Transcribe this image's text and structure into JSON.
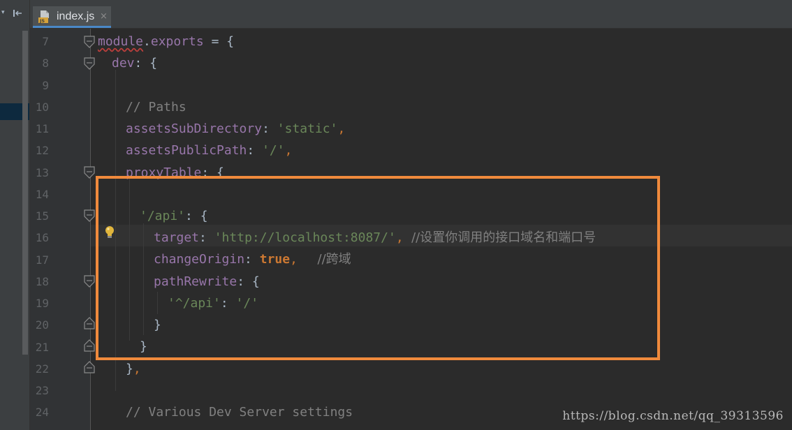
{
  "tab": {
    "filename": "index.js",
    "close_symbol": "×",
    "icon": "js-file-icon"
  },
  "left_panel": {
    "collapse_symbol": "▾",
    "pin_icon": "pin-to-left-icon"
  },
  "line_numbers": [
    "7",
    "8",
    "9",
    "10",
    "11",
    "12",
    "13",
    "14",
    "15",
    "16",
    "17",
    "18",
    "19",
    "20",
    "21",
    "22",
    "23",
    "24"
  ],
  "code": {
    "l7": {
      "a": "module",
      "b": ".",
      "c": "exports",
      "d": " = {"
    },
    "l8": {
      "a": "dev",
      "b": ": {"
    },
    "l10": {
      "a": "// Paths"
    },
    "l11": {
      "a": "assetsSubDirectory",
      "b": ": ",
      "c": "'static'",
      "d": ","
    },
    "l12": {
      "a": "assetsPublicPath",
      "b": ": ",
      "c": "'/'",
      "d": ","
    },
    "l13": {
      "a": "proxyTable",
      "b": ": {"
    },
    "l15": {
      "a": "'/api'",
      "b": ": {"
    },
    "l16": {
      "a": "target",
      "b": ": ",
      "c": "'http://localhost:8087/'",
      "d": ",",
      "e": "  //设置你调用的接口域名和端口号"
    },
    "l17": {
      "a": "changeOrigin",
      "b": ": ",
      "c": "true",
      "d": ",",
      "e": "     //跨域"
    },
    "l18": {
      "a": "pathRewrite",
      "b": ": {"
    },
    "l19": {
      "a": "'^/api'",
      "b": ": ",
      "c": "'/'"
    },
    "l20": {
      "a": "}"
    },
    "l21": {
      "a": "}"
    },
    "l22": {
      "a": "}",
      "b": ","
    },
    "l24": {
      "a": "// Various Dev Server settings"
    }
  },
  "watermark": "https://blog.csdn.net/qq_39313596",
  "colors": {
    "highlight_box": "#f08a3c",
    "property": "#9876aa",
    "string": "#6a8759",
    "comment": "#808080",
    "keyword": "#cc7832"
  }
}
